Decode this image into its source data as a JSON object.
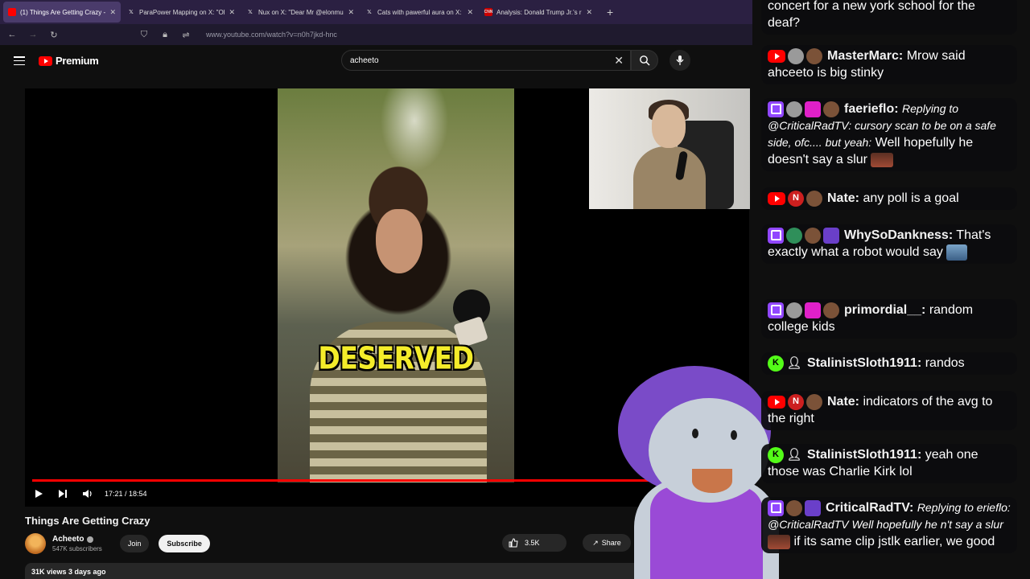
{
  "browser": {
    "tabs": [
      {
        "title": "(1) Things Are Getting Crazy - Y",
        "active": true,
        "icon": "youtube-icon"
      },
      {
        "title": "ParaPower Mapping on X: \"Oh",
        "active": false,
        "icon": "x-icon"
      },
      {
        "title": "Nux on X: \"Dear Mr @elonmusk",
        "active": false,
        "icon": "x-icon"
      },
      {
        "title": "Cats with pawerful aura on X: \"I",
        "active": false,
        "icon": "x-icon"
      },
      {
        "title": "Analysis: Donald Trump Jr.'s rea",
        "active": false,
        "icon": "cnn-icon"
      }
    ],
    "new_tab": "+",
    "url": "www.youtube.com/watch?v=n0h7jkd-hnc"
  },
  "youtube": {
    "logo_text": "Premium",
    "search_value": "acheeto",
    "video": {
      "caption": "DESERVED",
      "time": "17:21 / 18:54",
      "progress": 0.918
    },
    "title": "Things Are Getting Crazy",
    "channel": {
      "name": "Acheeto",
      "subscribers": "547K subscribers"
    },
    "join_label": "Join",
    "subscribe_label": "Subscribe",
    "likes": "3.5K",
    "share_label": "Share",
    "meta": "31K views  3 days ago"
  },
  "chat": {
    "messages": [
      {
        "badges": [],
        "user": "",
        "text": "concert for a new york school for the deaf?"
      },
      {
        "badges": [
          "yt",
          "gray",
          "brown"
        ],
        "user": "MasterMarc:",
        "text": "Mrow said ahceeto is big stinky"
      },
      {
        "badges": [
          "tw",
          "gray",
          "gem",
          "brown"
        ],
        "user": "faerieflo:",
        "reply": "Replying to @CriticalRadTV: cursory scan to be on a safe side, ofc.... but yeah:",
        "text": "Well hopefully he doesn't say a slur"
      },
      {
        "badges": [
          "yt",
          "n",
          "brown"
        ],
        "user": "Nate:",
        "text": "any poll is a goal"
      },
      {
        "badges": [
          "tw",
          "green",
          "brown",
          "purple"
        ],
        "user": "WhySoDankness:",
        "text": "That's exactly what a robot would say"
      },
      {
        "badges": [
          "tw",
          "gray",
          "gem",
          "brown"
        ],
        "user": "primordial__:",
        "text": "random college kids"
      },
      {
        "badges": [
          "kick",
          "user-ic"
        ],
        "user": "StalinistSloth1911:",
        "text": "randos"
      },
      {
        "badges": [
          "yt",
          "n",
          "brown"
        ],
        "user": "Nate:",
        "text": "indicators of the avg to the right"
      },
      {
        "badges": [
          "kick",
          "user-ic"
        ],
        "user": "StalinistSloth1911:",
        "text": "yeah one those was Charlie Kirk lol"
      },
      {
        "badges": [
          "tw",
          "brown",
          "purple"
        ],
        "user": "CriticalRadTV:",
        "reply": "Replying to erieflo: @CriticalRadTV Well hopefully he n't say a slur",
        "text": "if its same clip jstlk earlier, we good"
      }
    ]
  }
}
